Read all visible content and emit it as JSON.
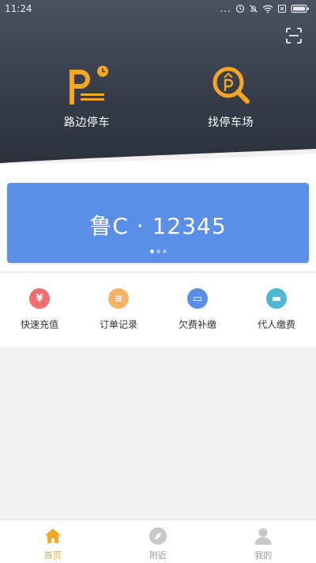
{
  "status_bar": {
    "time": "11:24",
    "dots": "...",
    "icons": [
      "alarm-icon",
      "mute-icon",
      "wifi-icon",
      "sim-icon",
      "battery-icon"
    ]
  },
  "header": {
    "scan_icon": "scan-icon",
    "features": [
      {
        "label": "路边停车",
        "icon": "roadside-parking-icon"
      },
      {
        "label": "找停车场",
        "icon": "find-parking-lot-icon"
      }
    ]
  },
  "plate": {
    "number": "鲁C · 12345",
    "pages": 3,
    "active_page": 1
  },
  "actions": [
    {
      "label": "快速充值",
      "icon": "yuan-icon",
      "color": "#f26d6d",
      "glyph": "¥"
    },
    {
      "label": "订单记录",
      "icon": "order-list-icon",
      "color": "#f7b267",
      "glyph": "≡"
    },
    {
      "label": "欠费补缴",
      "icon": "wallet-icon",
      "color": "#5a8fe8",
      "glyph": "▭"
    },
    {
      "label": "代人缴费",
      "icon": "card-icon",
      "color": "#4fb8d6",
      "glyph": "▬"
    }
  ],
  "bottom_nav": [
    {
      "label": "首页",
      "icon": "home-icon",
      "active": true
    },
    {
      "label": "附近",
      "icon": "compass-icon",
      "active": false
    },
    {
      "label": "我的",
      "icon": "user-icon",
      "active": false
    }
  ],
  "colors": {
    "header_dark": "#353c48",
    "accent_orange": "#f5a623",
    "plate_blue": "#5a8fe8",
    "background": "#f1f1f1"
  }
}
